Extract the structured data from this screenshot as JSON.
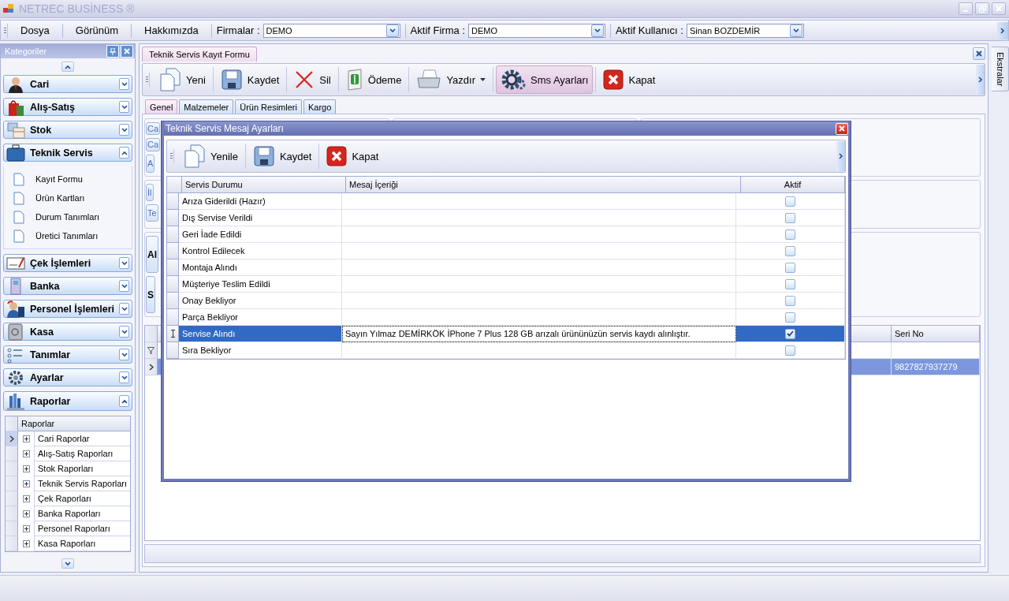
{
  "app": {
    "title": "NETREC BUSİNESS ®"
  },
  "menu": [
    {
      "label": "Dosya"
    },
    {
      "label": "Görünüm"
    },
    {
      "label": "Hakkımızda"
    }
  ],
  "selectors": [
    {
      "label": "Firmalar :",
      "value": "DEMO"
    },
    {
      "label": "Aktif Firma :",
      "value": "DEMO"
    },
    {
      "label": "Aktif Kullanıcı :",
      "value": "Sinan BOZDEMİR"
    }
  ],
  "sidebar": {
    "title": "Kategoriler",
    "groups": [
      {
        "label": "Cari",
        "expanded": false
      },
      {
        "label": "Alış-Satış",
        "expanded": false
      },
      {
        "label": "Stok",
        "expanded": false
      },
      {
        "label": "Teknik Servis",
        "expanded": true,
        "kind": "list",
        "items": [
          {
            "label": "Kayıt Formu"
          },
          {
            "label": "Ürün Kartları"
          },
          {
            "label": "Durum Tanımları"
          },
          {
            "label": "Üretici Tanımları"
          }
        ]
      },
      {
        "label": "Çek İşlemleri",
        "expanded": false
      },
      {
        "label": "Banka",
        "expanded": false
      },
      {
        "label": "Personel İşlemleri",
        "expanded": false
      },
      {
        "label": "Kasa",
        "expanded": false
      },
      {
        "label": "Tanımlar",
        "expanded": false
      },
      {
        "label": "Ayarlar",
        "expanded": false
      },
      {
        "label": "Raporlar",
        "expanded": true,
        "kind": "tree",
        "column": "Raporlar",
        "nodes": [
          {
            "label": "Cari Raporlar",
            "selected": true,
            "expanded": false
          },
          {
            "label": "Alış-Satış Raporları",
            "selected": false,
            "expanded": false
          },
          {
            "label": "Stok Raporları",
            "selected": false,
            "expanded": false
          },
          {
            "label": "Teknik Servis Raporları",
            "selected": false,
            "expanded": false
          },
          {
            "label": "Çek Raporları",
            "selected": false,
            "expanded": false
          },
          {
            "label": "Banka Raporları",
            "selected": false,
            "expanded": false
          },
          {
            "label": "Personel Raporları",
            "selected": false,
            "expanded": false
          },
          {
            "label": "Kasa Raporları",
            "selected": false,
            "expanded": false
          }
        ]
      }
    ]
  },
  "document_tabs": [
    {
      "label": "Teknik Servis Kayıt Formu",
      "selected": true
    }
  ],
  "toolbar": [
    {
      "label": "Yeni",
      "pressed": false
    },
    {
      "label": "Kaydet",
      "pressed": false
    },
    {
      "label": "Sil",
      "pressed": false
    },
    {
      "label": "Ödeme",
      "pressed": false
    },
    {
      "label": "Yazdır",
      "pressed": false,
      "dropdown": true
    },
    {
      "label": "Sms Ayarları",
      "pressed": true
    },
    {
      "label": "Kapat",
      "pressed": false
    }
  ],
  "form_tabs": [
    {
      "label": "Genel",
      "selected": true
    },
    {
      "label": "Malzemeler",
      "selected": false
    },
    {
      "label": "Ürün Resimleri",
      "selected": false
    },
    {
      "label": "Kargo",
      "selected": false
    }
  ],
  "form_fragments": [
    {
      "label": "Ca"
    },
    {
      "label": "Ca"
    },
    {
      "label": "A"
    },
    {
      "label": "İl"
    },
    {
      "label": "Te"
    }
  ],
  "form_big_fragments": [
    {
      "label": "Al"
    },
    {
      "label": "S"
    }
  ],
  "background_grid": {
    "columns": [
      "Seri No"
    ],
    "rows": [
      {
        "values": [
          "9827827937279"
        ],
        "selected": true
      }
    ]
  },
  "side_tab": {
    "label": "Ekstralar"
  },
  "dialog": {
    "title": "Teknik Servis Mesaj Ayarları",
    "toolbar": [
      {
        "label": "Yenile"
      },
      {
        "label": "Kaydet"
      },
      {
        "label": "Kapat"
      }
    ],
    "columns": [
      "Servis Durumu",
      "Mesaj İçeriği",
      "Aktif"
    ],
    "rows": [
      {
        "status": "Arıza Giderildi (Hazır)",
        "active": false,
        "selected": false
      },
      {
        "status": "Dış Servise Verildi",
        "active": false,
        "selected": false
      },
      {
        "status": "Geri İade Edildi",
        "active": false,
        "selected": false
      },
      {
        "status": "Kontrol Edilecek",
        "active": false,
        "selected": false
      },
      {
        "status": "Montaja Alındı",
        "active": false,
        "selected": false
      },
      {
        "status": "Müşteriye Teslim Edildi",
        "active": false,
        "selected": false
      },
      {
        "status": "Onay Bekliyor",
        "active": false,
        "selected": false
      },
      {
        "status": "Parça Bekliyor",
        "active": false,
        "selected": false
      },
      {
        "status": "Servise Alındı",
        "message": "Sayın Yılmaz DEMİRKÖK İPhone 7 Plus 128 GB arızalı ürününüzün servis kaydı alınlıştır.",
        "active": true,
        "selected": true
      },
      {
        "status": "Sıra Bekliyor",
        "active": false,
        "selected": false
      }
    ]
  }
}
